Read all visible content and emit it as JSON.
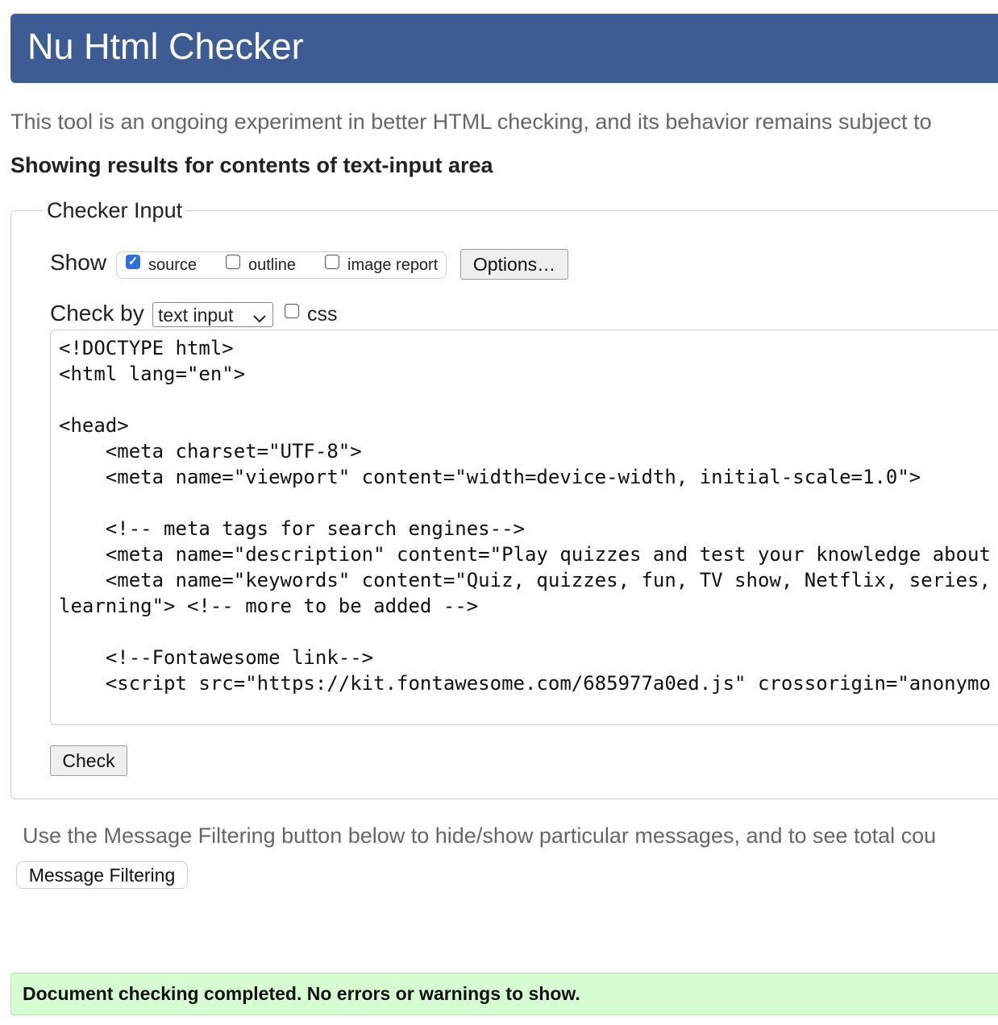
{
  "header": {
    "title": "Nu Html Checker"
  },
  "intro_text": "This tool is an ongoing experiment in better HTML checking, and its behavior remains subject to",
  "results_heading": "Showing results for contents of text-input area",
  "checker_input": {
    "legend": "Checker Input",
    "show_label": "Show",
    "show_options": [
      {
        "label": "source",
        "checked": true
      },
      {
        "label": "outline",
        "checked": false
      },
      {
        "label": "image report",
        "checked": false
      }
    ],
    "options_button": "Options…",
    "check_by_label": "Check by",
    "check_by_value": "text input",
    "css_label": "css",
    "css_checked": false,
    "source_code": "<!DOCTYPE html>\n<html lang=\"en\">\n\n<head>\n    <meta charset=\"UTF-8\">\n    <meta name=\"viewport\" content=\"width=device-width, initial-scale=1.0\">\n\n    <!-- meta tags for search engines-->\n    <meta name=\"description\" content=\"Play quizzes and test your knowledge about\n    <meta name=\"keywords\" content=\"Quiz, quizzes, fun, TV show, Netflix, series,\nlearning\"> <!-- more to be added -->\n\n    <!--Fontawesome link-->\n    <script src=\"https://kit.fontawesome.com/685977a0ed.js\" crossorigin=\"anonymo",
    "check_button": "Check"
  },
  "filter_note": "Use the Message Filtering button below to hide/show particular messages, and to see total cou",
  "message_filtering_button": "Message Filtering",
  "success_message": "Document checking completed. No errors or warnings to show.",
  "colors": {
    "header_bg": "#3d5c94",
    "success_bg": "#d6fdd1",
    "checkbox_checked": "#2e6fe0"
  }
}
